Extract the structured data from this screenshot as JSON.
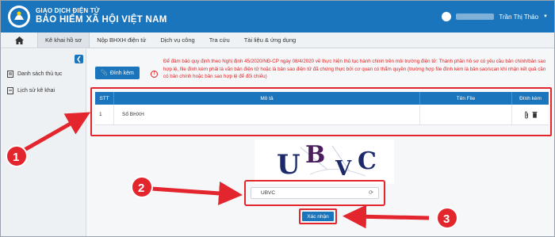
{
  "header": {
    "brand_line1": "GIAO DỊCH ĐIỆN TỬ",
    "brand_line2": "BẢO HIỂM XÃ HỘI VIỆT NAM",
    "user_name": "Trần Thị Thảo",
    "user_icon": "user-circle-icon"
  },
  "nav": {
    "home_icon": "home-icon",
    "items": [
      {
        "label": "Kê khai hồ sơ",
        "active": true
      },
      {
        "label": "Nộp BHXH điện tử",
        "active": false
      },
      {
        "label": "Dịch vụ công",
        "active": false
      },
      {
        "label": "Tra cứu",
        "active": false
      },
      {
        "label": "Tài liệu & ứng dụng",
        "active": false
      }
    ]
  },
  "sidebar": {
    "items": [
      {
        "label": "Danh sách thủ tục",
        "icon": "document-list-icon"
      },
      {
        "label": "Lịch sử kê khai",
        "icon": "history-icon"
      }
    ]
  },
  "main": {
    "attach_label": "Đính kèm",
    "notice": "Để đảm bảo quy định theo Nghị định 45/2020/NĐ-CP ngày 08/4/2020 về thực hiện thủ tục hành chính trên môi trường điện tử: Thành phần hồ sơ có yêu cầu bản chính/bản sao hợp lệ, file đính kèm phải là văn bản điện tử hoặc là bản sao điện tử đã chứng thực bởi cơ quan có thẩm quyền (trường hợp file đính kèm là bản sao/scan khi nhận kết quả cần có bản chính hoặc bản sao hợp lệ để đối chiếu)",
    "table": {
      "headers": [
        "STT",
        "Mô tả",
        "Tên File",
        "Đính kèm"
      ],
      "rows": [
        {
          "stt": "1",
          "description": "Sổ BHXH",
          "file_name": ""
        }
      ]
    },
    "captcha": {
      "letters": [
        "U",
        "B",
        "V",
        "C"
      ],
      "input_value": "UBVC"
    },
    "confirm_label": "Xác nhận"
  },
  "annotations": {
    "markers": [
      "1",
      "2",
      "3"
    ],
    "highlight_color": "#e3262d",
    "accent": "#1b75bc"
  }
}
